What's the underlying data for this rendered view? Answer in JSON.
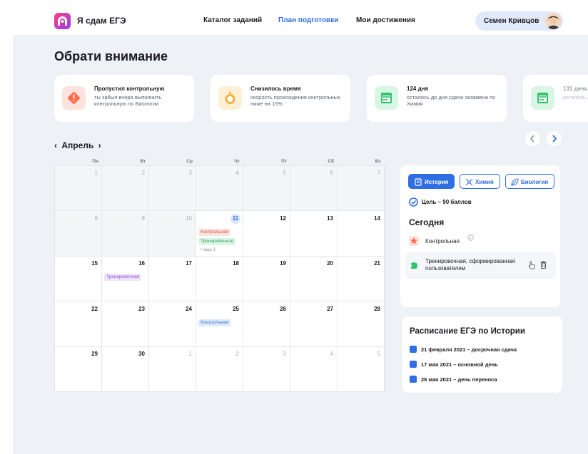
{
  "header": {
    "brand": "Я сдам ЕГЭ",
    "nav": [
      {
        "label": "Каталог заданий",
        "active": false
      },
      {
        "label": "План подготовки",
        "active": true
      },
      {
        "label": "Мои достижения",
        "active": false
      }
    ],
    "user_name": "Семен Кривцов"
  },
  "attention": {
    "title": "Обрати внимание",
    "cards": [
      {
        "icon": "warning-icon",
        "color": "#ff6b4a",
        "title": "Пропустил контрольную",
        "text": "ты забыл вчера выполнить контрольную по Биологии"
      },
      {
        "icon": "stopwatch-icon",
        "color": "#f3b33d",
        "title": "Снизилось время",
        "text": "скорость прохождения контрольных ниже на 15%"
      },
      {
        "icon": "calendar-icon",
        "color": "#2fc26d",
        "title": "124 дня",
        "text": "осталось до дня сдачи экзамена по Химии"
      },
      {
        "icon": "calendar-icon",
        "color": "#2fc26d",
        "title": "131 день",
        "text": "осталось до дня сдачи экзамена"
      }
    ]
  },
  "calendar": {
    "month": "Апрель",
    "weekdays": [
      "Пн",
      "Вт",
      "Ср",
      "Чт",
      "Пт",
      "Сб",
      "Вс"
    ],
    "weeks": [
      [
        {
          "day": "1",
          "state": "past"
        },
        {
          "day": "2",
          "state": "past"
        },
        {
          "day": "3",
          "state": "past"
        },
        {
          "day": "4",
          "state": "past"
        },
        {
          "day": "5",
          "state": "past"
        },
        {
          "day": "6",
          "state": "past"
        },
        {
          "day": "7",
          "state": "past"
        }
      ],
      [
        {
          "day": "8",
          "state": "past"
        },
        {
          "day": "9",
          "state": "past"
        },
        {
          "day": "10",
          "state": "past"
        },
        {
          "day": "11",
          "state": "today",
          "events": [
            {
              "label": "Контрольная",
              "color": "red"
            },
            {
              "label": "Тренировочная",
              "color": "green"
            }
          ],
          "more": "+ еще 3"
        },
        {
          "day": "12",
          "state": "normal"
        },
        {
          "day": "13",
          "state": "normal"
        },
        {
          "day": "14",
          "state": "normal"
        }
      ],
      [
        {
          "day": "15",
          "state": "normal"
        },
        {
          "day": "16",
          "state": "normal",
          "events": [
            {
              "label": "Тренировочная",
              "color": "purple"
            }
          ]
        },
        {
          "day": "17",
          "state": "normal"
        },
        {
          "day": "18",
          "state": "normal"
        },
        {
          "day": "19",
          "state": "normal"
        },
        {
          "day": "20",
          "state": "normal"
        },
        {
          "day": "21",
          "state": "normal"
        }
      ],
      [
        {
          "day": "22",
          "state": "normal"
        },
        {
          "day": "23",
          "state": "normal"
        },
        {
          "day": "24",
          "state": "normal"
        },
        {
          "day": "25",
          "state": "normal",
          "events": [
            {
              "label": "Контрольная",
              "color": "blue"
            }
          ]
        },
        {
          "day": "26",
          "state": "normal"
        },
        {
          "day": "27",
          "state": "normal"
        },
        {
          "day": "28",
          "state": "normal"
        }
      ],
      [
        {
          "day": "29",
          "state": "normal"
        },
        {
          "day": "30",
          "state": "normal"
        },
        {
          "day": "1",
          "state": "other"
        },
        {
          "day": "2",
          "state": "other"
        },
        {
          "day": "3",
          "state": "other"
        },
        {
          "day": "4",
          "state": "other"
        },
        {
          "day": "5",
          "state": "other"
        }
      ]
    ]
  },
  "panel": {
    "subjects": [
      {
        "label": "История",
        "icon": "book-icon",
        "active": true
      },
      {
        "label": "Химия",
        "icon": "molecule-icon",
        "active": false
      },
      {
        "label": "Биология",
        "icon": "leaf-icon",
        "active": false
      }
    ],
    "goal": "Цель – 90 баллов",
    "today_title": "Сегодня",
    "events": [
      {
        "label": "Контрольная",
        "icon": "star-icon",
        "color": "#ff6b4a"
      },
      {
        "label": "Тренировочная, сформированная пользователем",
        "icon": "puzzle-icon",
        "color": "#2fc26d"
      }
    ]
  },
  "schedule": {
    "title": "Расписание ЕГЭ по Истории",
    "items": [
      "21 февраля 2021 – досрочная сдача",
      "17 мая 2021 – основной день",
      "28 мая 2021 – день переноса"
    ]
  },
  "colors": {
    "accent": "#2f6fe4",
    "background": "#eef1f6"
  }
}
